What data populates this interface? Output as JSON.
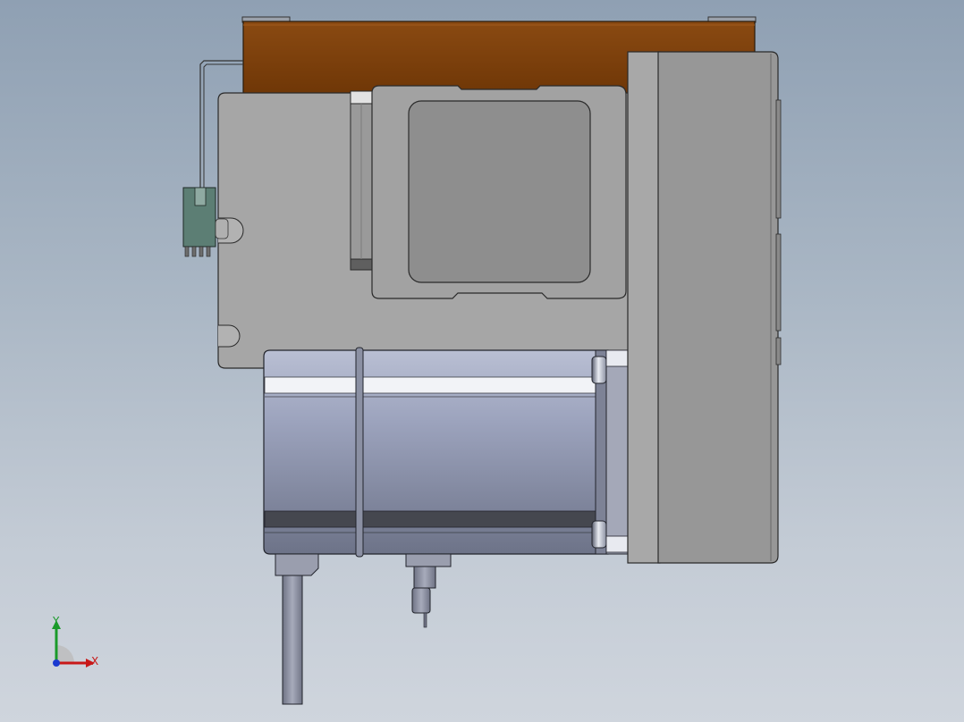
{
  "viewport": {
    "background_top": "#8fa0b3",
    "background_bottom": "#cfd5dd"
  },
  "colors": {
    "copper_block": "#7a3c08",
    "plate": "#a4a4a4",
    "frame": "#9e9e9e",
    "window": "#8c8c8c",
    "housing": "#989898",
    "motor_light": "#aab0c8",
    "motor_dark": "#6a6f84",
    "motor_band": "#45474f",
    "connector": "#5c7e74"
  },
  "triad": {
    "y_label": "Y",
    "x_label": "X",
    "y_color": "#1a9a2a",
    "x_color": "#c81818",
    "z_color": "#1a3ad0",
    "icon": "coordinate-triad-icon"
  }
}
